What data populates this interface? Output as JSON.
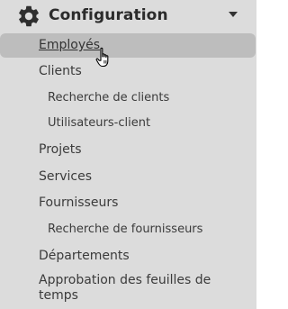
{
  "header": {
    "title": "Configuration",
    "icon": "gear-icon",
    "caret_icon": "chevron-down-icon"
  },
  "menu": {
    "items": [
      {
        "label": "Employés",
        "level": 1,
        "active": true
      },
      {
        "label": "Clients",
        "level": 1
      },
      {
        "label": "Recherche de clients",
        "level": 2
      },
      {
        "label": "Utilisateurs-client",
        "level": 2
      },
      {
        "label": "Projets",
        "level": 1
      },
      {
        "label": "Services",
        "level": 1
      },
      {
        "label": "Fournisseurs",
        "level": 1
      },
      {
        "label": "Recherche de fournisseurs",
        "level": 2
      },
      {
        "label": "Départements",
        "level": 1
      },
      {
        "label": "Approbation des feuilles de temps",
        "level": 1
      }
    ]
  },
  "colors": {
    "panel_bg": "#dcdcdc",
    "active_bg": "#bdbdbd",
    "text": "#3b3b3b"
  }
}
